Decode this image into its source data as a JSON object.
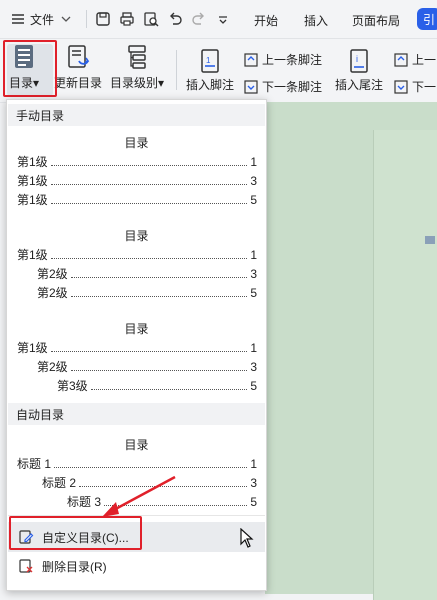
{
  "topbar": {
    "menu_label": "文件",
    "tabs": [
      "开始",
      "插入",
      "页面布局"
    ],
    "badge": "引"
  },
  "ribbon": {
    "toc_label": "目录",
    "update_toc_label": "更新目录",
    "toc_level_label": "目录级别",
    "insert_footnote_label": "插入脚注",
    "prev_footnote_label": "上一条脚注",
    "next_footnote_label": "下一条脚注",
    "insert_endnote_label": "插入尾注",
    "prev_clipped": "上一",
    "next_clipped": "下一"
  },
  "dropdown": {
    "manual_header": "手动目录",
    "auto_header": "自动目录",
    "toc_title": "目录",
    "template1": [
      {
        "text": "第1级",
        "page": "1"
      },
      {
        "text": "第1级",
        "page": "3"
      },
      {
        "text": "第1级",
        "page": "5"
      }
    ],
    "template2": [
      {
        "text": "第1级",
        "page": "1"
      },
      {
        "text": "第2级",
        "page": "3"
      },
      {
        "text": "第2级",
        "page": "5"
      }
    ],
    "template3": [
      {
        "text": "第1级",
        "page": "1"
      },
      {
        "text": "第2级",
        "page": "3"
      },
      {
        "text": "第3级",
        "page": "5"
      }
    ],
    "auto_template": [
      {
        "text": "标题 1",
        "page": "1"
      },
      {
        "text": "标题 2",
        "page": "3"
      },
      {
        "text": "标题 3",
        "page": "5"
      }
    ],
    "custom_toc_label": "自定义目录(C)...",
    "delete_toc_label": "删除目录(R)"
  },
  "colors": {
    "highlight_red": "#e0202a",
    "doc_green": "#c9ddca",
    "accent_blue": "#2a60e8"
  }
}
